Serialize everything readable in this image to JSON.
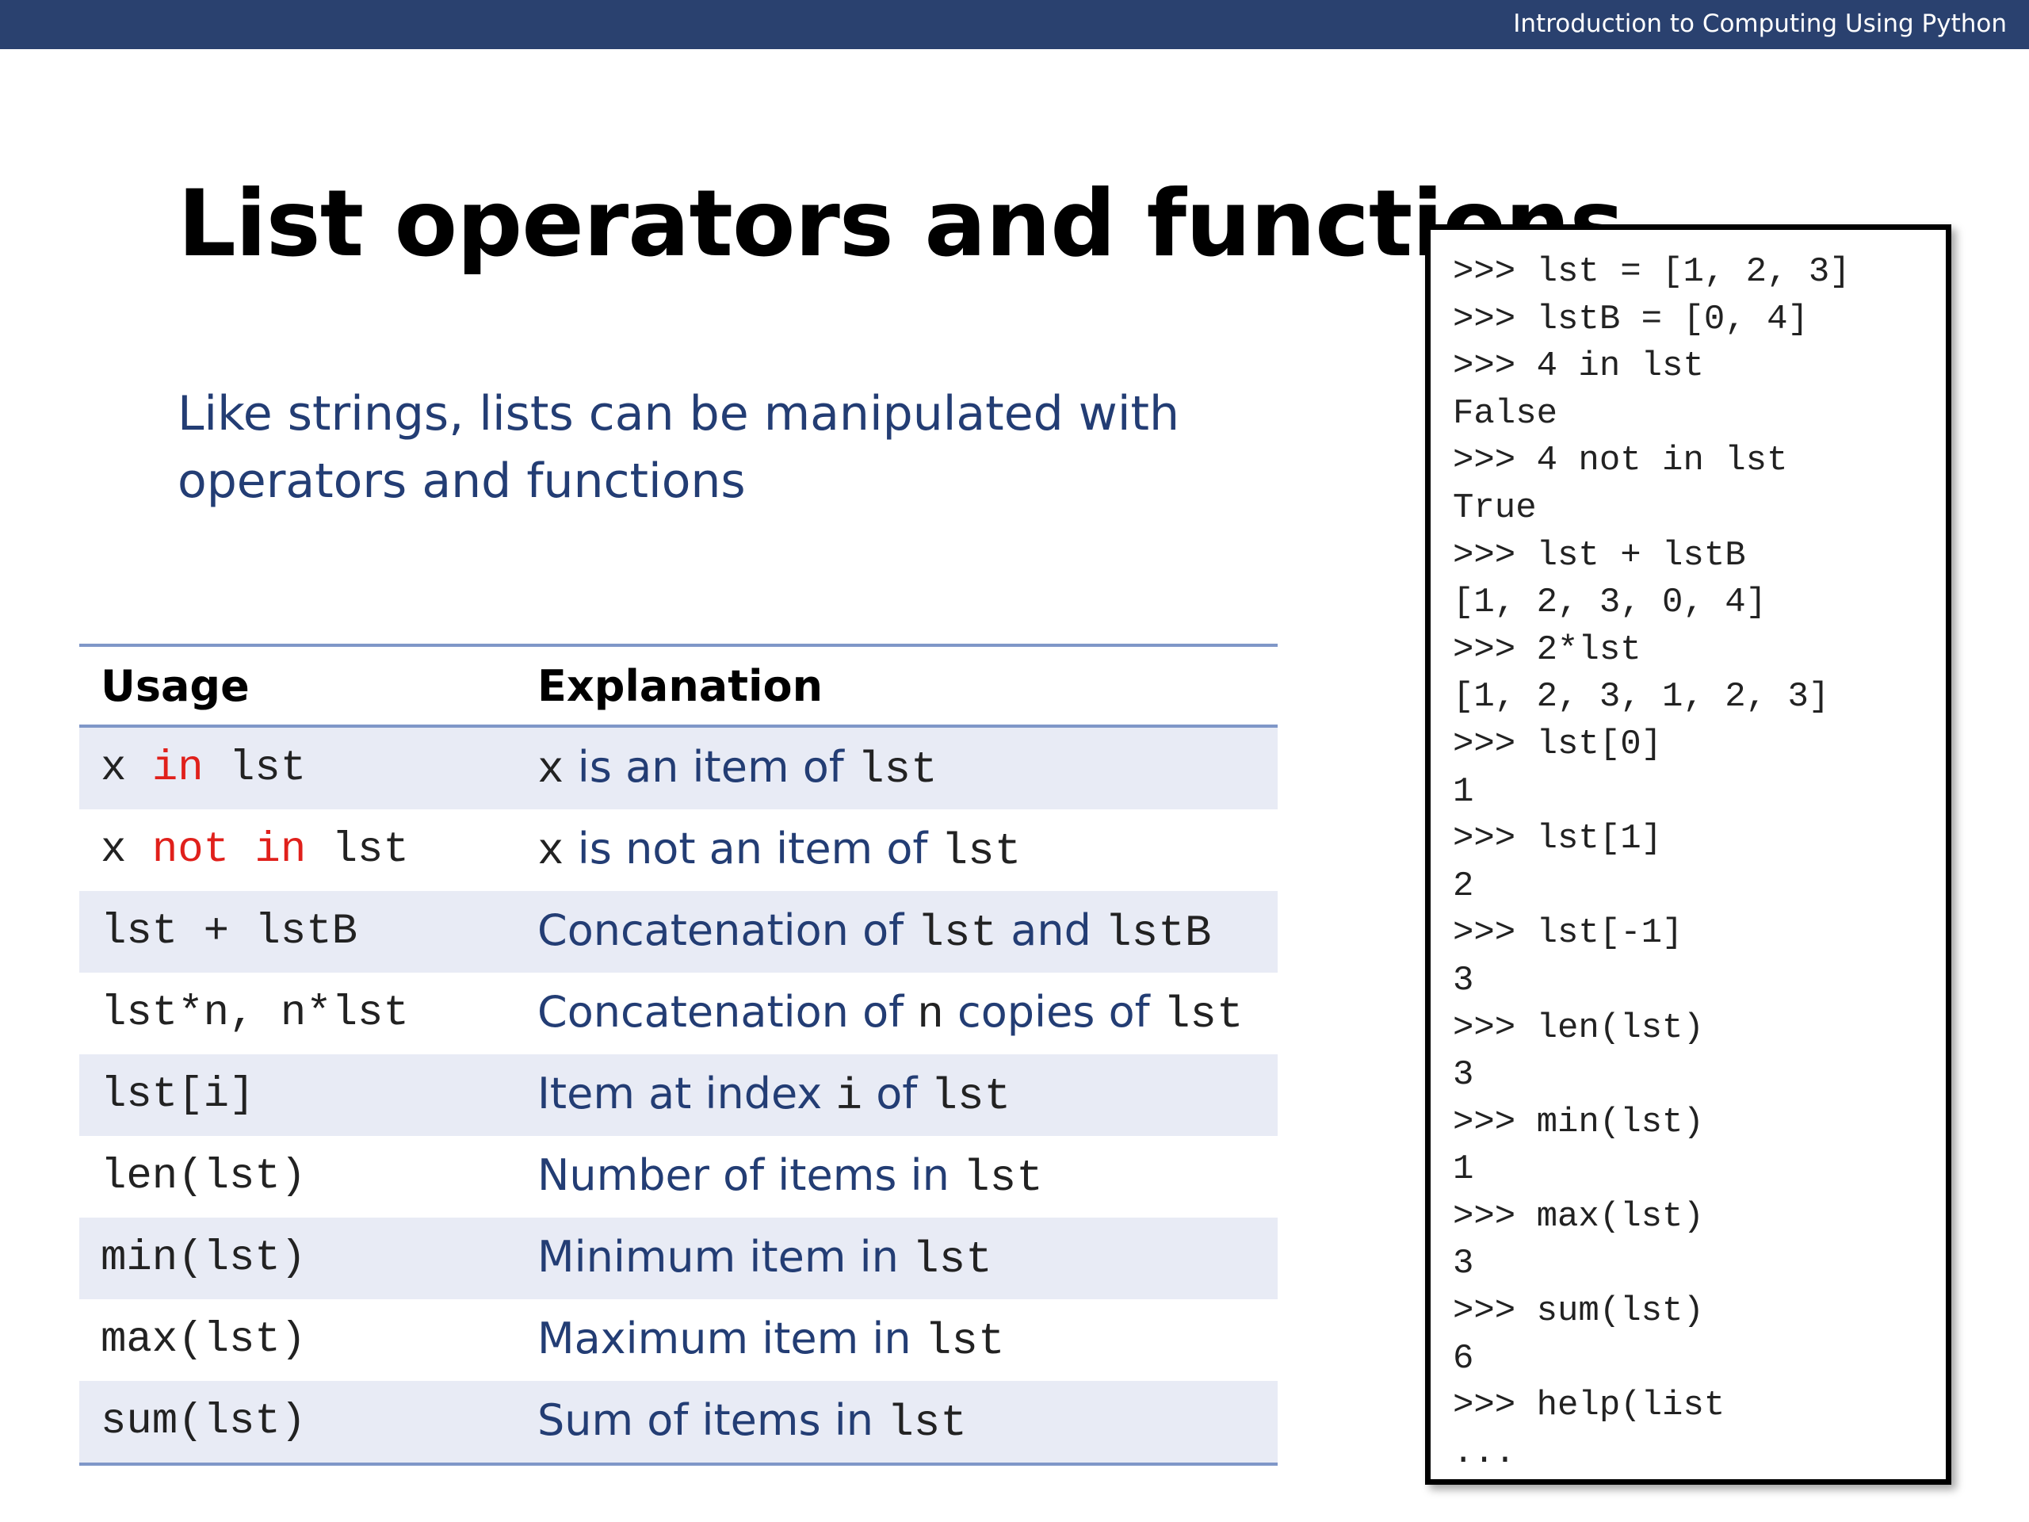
{
  "header": {
    "course_title": "Introduction to Computing Using Python"
  },
  "slide": {
    "title": "List operators and functions",
    "subtitle_line1": "Like strings, lists can be manipulated with",
    "subtitle_line2": "operators and functions"
  },
  "table": {
    "headers": {
      "usage": "Usage",
      "explanation": "Explanation"
    },
    "rows": [
      {
        "u1": "x ",
        "u2": "in",
        "u3": " lst",
        "e1": "x",
        "e2": " is an item of ",
        "e3": "lst"
      },
      {
        "u1": "x ",
        "u2": "not in",
        "u3": " lst",
        "e1": "x",
        "e2": " is not an item of ",
        "e3": "lst"
      },
      {
        "usage": "lst + lstB",
        "e1": "Concatenation of ",
        "e2": "lst",
        "e3": " and ",
        "e4": "lstB"
      },
      {
        "usage": "lst*n, n*lst",
        "e1": "Concatenation of ",
        "e2": "n",
        "e3": " copies of ",
        "e4": "lst"
      },
      {
        "usage": "lst[i]",
        "e1": "Item at index ",
        "e2": "i",
        "e3": " of ",
        "e4": "lst"
      },
      {
        "usage": "len(lst)",
        "e1": "Number of items in ",
        "e2": "lst"
      },
      {
        "usage": "min(lst)",
        "e1": "Minimum item in ",
        "e2": "lst"
      },
      {
        "usage": "max(lst)",
        "e1": "Maximum item in ",
        "e2": "lst"
      },
      {
        "usage": "sum(lst)",
        "e1": "Sum of items in ",
        "e2": "lst"
      }
    ]
  },
  "terminal": {
    "lines": [
      ">>> lst = [1, 2, 3]",
      ">>> lstB = [0, 4]",
      ">>> 4 in lst",
      "False",
      ">>> 4 not in lst",
      "True",
      ">>> lst + lstB",
      "[1, 2, 3, 0, 4]",
      ">>> 2*lst",
      "[1, 2, 3, 1, 2, 3]",
      ">>> lst[0]",
      "1",
      ">>> lst[1]",
      "2",
      ">>> lst[-1]",
      "3",
      ">>> len(lst)",
      "3",
      ">>> min(lst)",
      "1",
      ">>> max(lst)",
      "3",
      ">>> sum(lst)",
      "6",
      ">>> help(list",
      "..."
    ]
  }
}
